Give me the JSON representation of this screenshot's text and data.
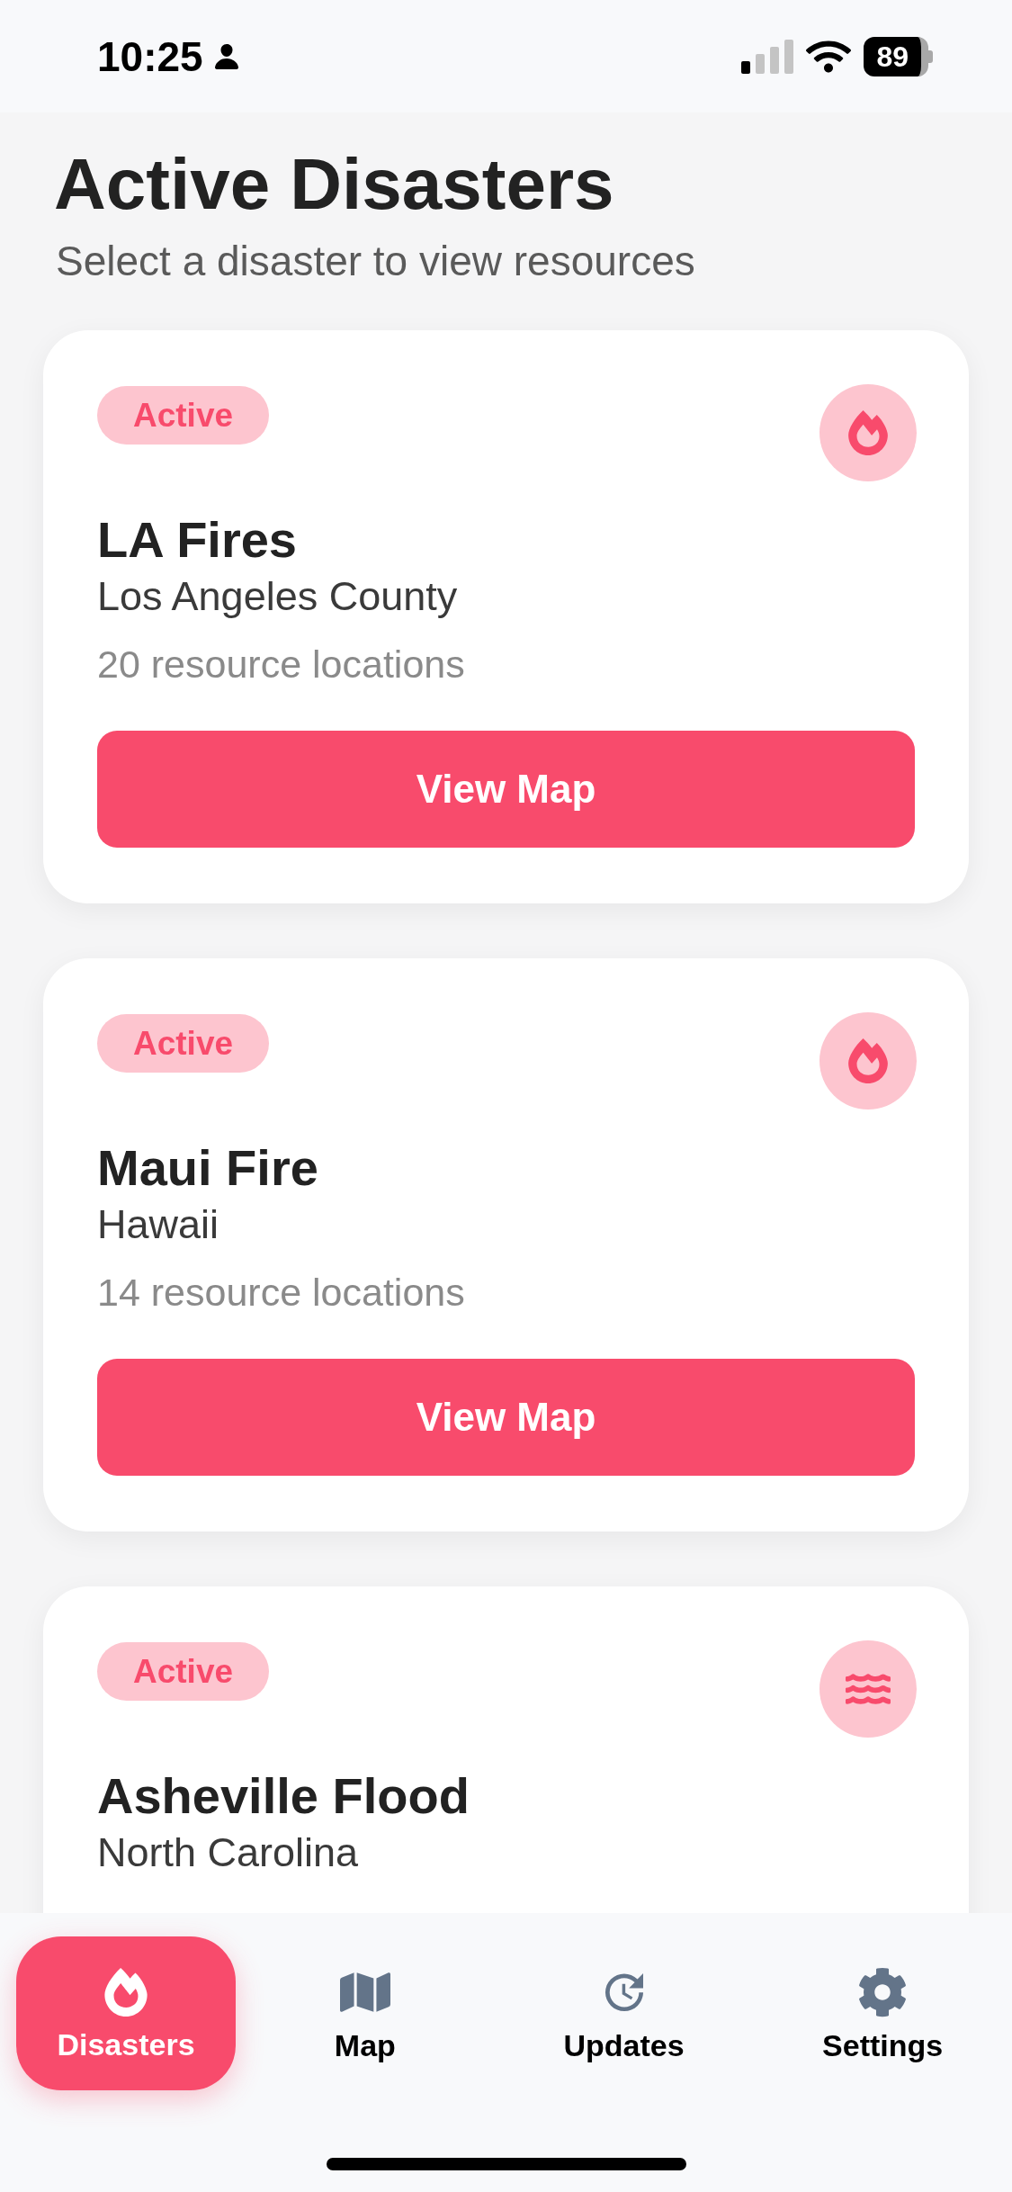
{
  "status_bar": {
    "time": "10:25",
    "battery": "89"
  },
  "header": {
    "title": "Active Disasters",
    "subtitle": "Select a disaster to view resources"
  },
  "disasters": [
    {
      "status": "Active",
      "kind": "fire",
      "name": "LA Fires",
      "location": "Los Angeles County",
      "resources": "20 resource locations",
      "action": "View Map"
    },
    {
      "status": "Active",
      "kind": "fire",
      "name": "Maui Fire",
      "location": "Hawaii",
      "resources": "14 resource locations",
      "action": "View Map"
    },
    {
      "status": "Active",
      "kind": "flood",
      "name": "Asheville Flood",
      "location": "North Carolina"
    }
  ],
  "tabs": [
    {
      "label": "Disasters",
      "kind": "disasters",
      "selected": true
    },
    {
      "label": "Map",
      "kind": "map",
      "selected": false
    },
    {
      "label": "Updates",
      "kind": "updates",
      "selected": false
    },
    {
      "label": "Settings",
      "kind": "settings",
      "selected": false
    }
  ]
}
